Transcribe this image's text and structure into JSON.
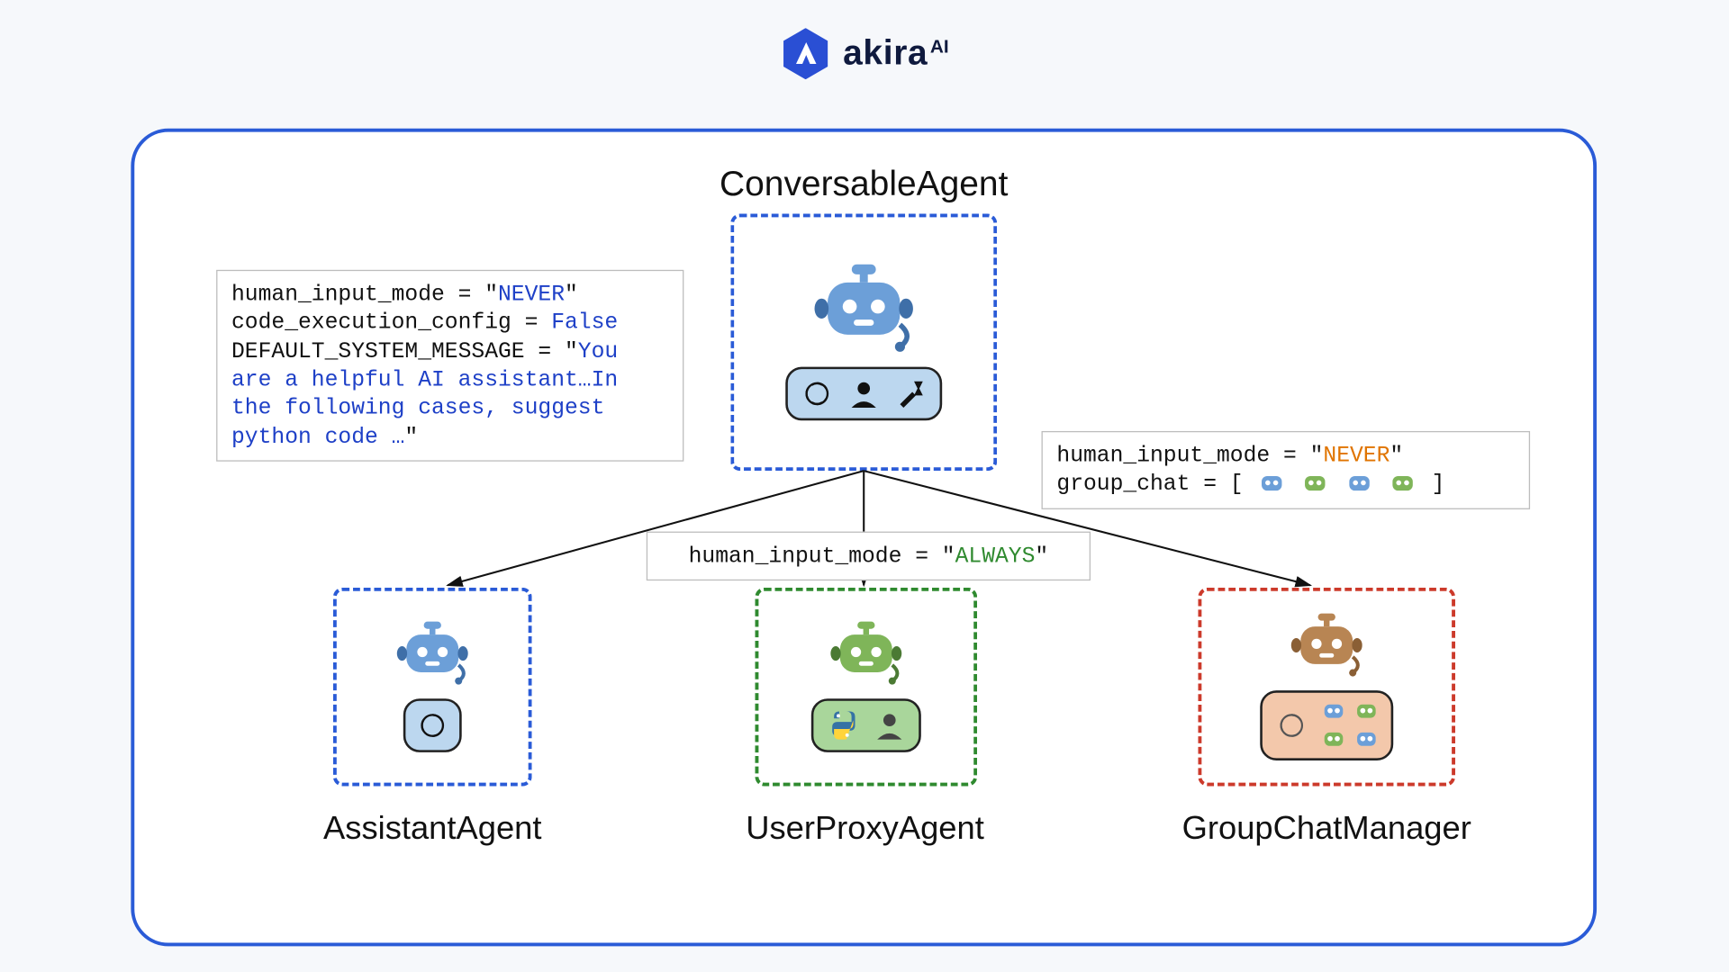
{
  "brand": {
    "name": "akira",
    "sup": "AI"
  },
  "labels": {
    "conversable": "ConversableAgent",
    "assistant": "AssistantAgent",
    "userproxy": "UserProxyAgent",
    "groupchat": "GroupChatManager"
  },
  "code_left": {
    "l1a": "human_input_mode = \"",
    "l1b": "NEVER",
    "l1c": "\"",
    "l2a": "code_execution_config = ",
    "l2b": "False",
    "l3a": "DEFAULT_SYSTEM_MESSAGE = \"",
    "l3b": "You are a helpful AI assistant…In the following cases, suggest python code …",
    "l3c": "\""
  },
  "code_mid": {
    "l1a": "human_input_mode = \"",
    "l1b": "ALWAYS",
    "l1c": "\""
  },
  "code_right": {
    "l1a": "human_input_mode = \"",
    "l1b": "NEVER",
    "l1c": "\"",
    "l2a": "group_chat = [ ",
    "l2b": " ]"
  }
}
